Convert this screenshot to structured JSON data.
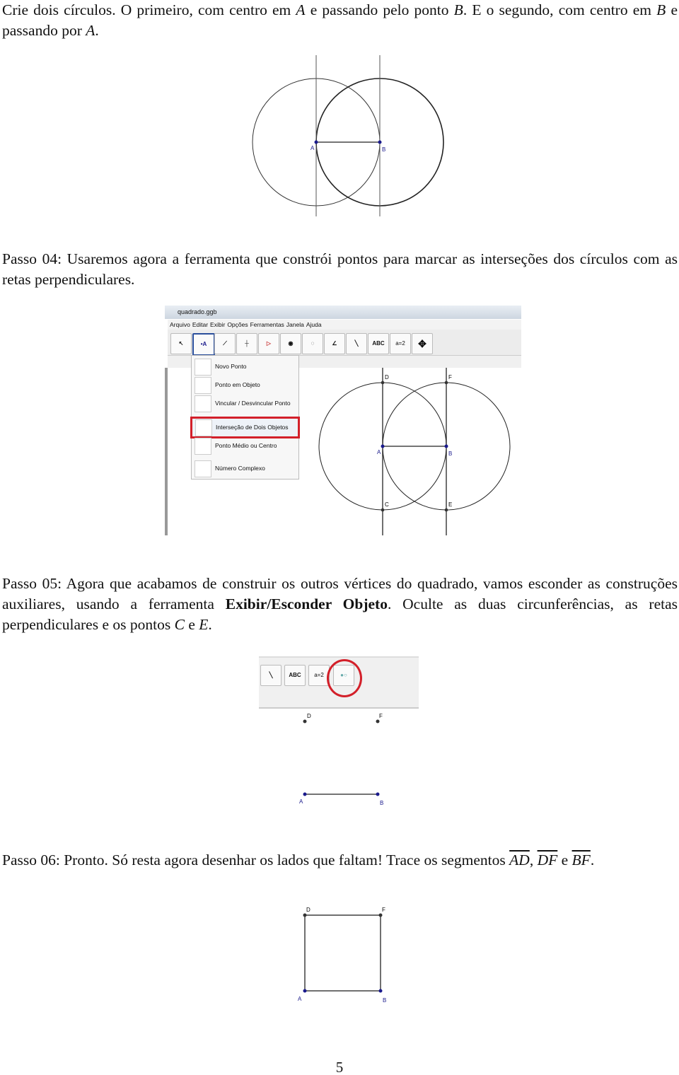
{
  "paragraphs": {
    "p1": {
      "t1": "Crie dois círculos. O primeiro, com centro em ",
      "m1": "A",
      "t2": " e passando pelo ponto ",
      "m2": "B",
      "t3": ". E o segundo, com centro em ",
      "m3": "B",
      "t4": " e passando por ",
      "m4": "A",
      "t5": "."
    },
    "p2": {
      "t1": "Passo 04: Usaremos agora a ferramenta que constrói pontos para marcar as interseções dos círculos com as retas perpendiculares."
    },
    "p3": {
      "t1": "Passo 05: Agora que acabamos de construir os outros vértices do quadrado, vamos esconder as construções auxiliares, usando a ferramenta ",
      "b1": "Exibir/Esconder Objeto",
      "t2": ". Oculte as duas circunferências, as retas perpendiculares e os pontos ",
      "m1": "C",
      "t3": " e ",
      "m2": "E",
      "t4": "."
    },
    "p4": {
      "t1": "Passo 06: Pronto. Só resta agora desenhar os lados que faltam! Trace os segmentos ",
      "s1": "AD",
      "t2": ", ",
      "s2": "DF",
      "t3": " e ",
      "s3": "BF",
      "t4": "."
    }
  },
  "figure_labels": {
    "A": "A",
    "B": "B",
    "C": "C",
    "D": "D",
    "E": "E",
    "F": "F"
  },
  "geogebra": {
    "window_title": "quadrado.ggb",
    "menu": [
      "Arquivo",
      "Editar",
      "Exibir",
      "Opções",
      "Ferramentas",
      "Janela",
      "Ajuda"
    ],
    "toolbar": [
      "move-icon",
      "new-point-icon",
      "line-icon",
      "perpendicular-icon",
      "polygon-icon",
      "circle-icon",
      "conic-icon",
      "angle-icon",
      "reflect-icon",
      "ABC",
      "a=2",
      "move-view-icon"
    ],
    "dropdown": [
      "Novo Ponto",
      "Ponto em Objeto",
      "Vincular / Desvincular Ponto",
      "Interseção de Dois Objetos",
      "Ponto Médio ou Centro",
      "Número Complexo"
    ],
    "highlighted": "Interseção de Dois Objetos",
    "toolbar2": [
      "reflect-icon",
      "ABC",
      "a=2",
      "show-hide-object-icon"
    ],
    "highlight_color": "#d3202a",
    "point_color": "#1a1a8c"
  },
  "page_number": "5"
}
